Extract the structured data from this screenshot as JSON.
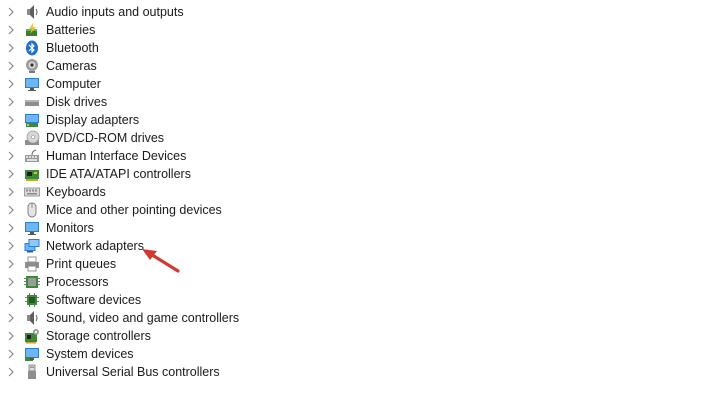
{
  "categories": [
    {
      "label": "Audio inputs and outputs",
      "icon": "speaker-icon"
    },
    {
      "label": "Batteries",
      "icon": "battery-icon"
    },
    {
      "label": "Bluetooth",
      "icon": "bluetooth-icon"
    },
    {
      "label": "Cameras",
      "icon": "camera-icon"
    },
    {
      "label": "Computer",
      "icon": "computer-icon"
    },
    {
      "label": "Disk drives",
      "icon": "disk-drive-icon"
    },
    {
      "label": "Display adapters",
      "icon": "display-adapter-icon"
    },
    {
      "label": "DVD/CD-ROM drives",
      "icon": "dvd-drive-icon"
    },
    {
      "label": "Human Interface Devices",
      "icon": "hid-icon"
    },
    {
      "label": "IDE ATA/ATAPI controllers",
      "icon": "ide-controller-icon"
    },
    {
      "label": "Keyboards",
      "icon": "keyboard-icon"
    },
    {
      "label": "Mice and other pointing devices",
      "icon": "mouse-icon"
    },
    {
      "label": "Monitors",
      "icon": "monitor-icon"
    },
    {
      "label": "Network adapters",
      "icon": "network-adapter-icon"
    },
    {
      "label": "Print queues",
      "icon": "printer-icon"
    },
    {
      "label": "Processors",
      "icon": "processor-icon"
    },
    {
      "label": "Software devices",
      "icon": "software-device-icon"
    },
    {
      "label": "Sound, video and game controllers",
      "icon": "sound-icon"
    },
    {
      "label": "Storage controllers",
      "icon": "storage-controller-icon"
    },
    {
      "label": "System devices",
      "icon": "system-device-icon"
    },
    {
      "label": "Universal Serial Bus controllers",
      "icon": "usb-icon"
    }
  ],
  "annotation": {
    "icon": "red-arrow-icon",
    "color": "#d03a30"
  }
}
